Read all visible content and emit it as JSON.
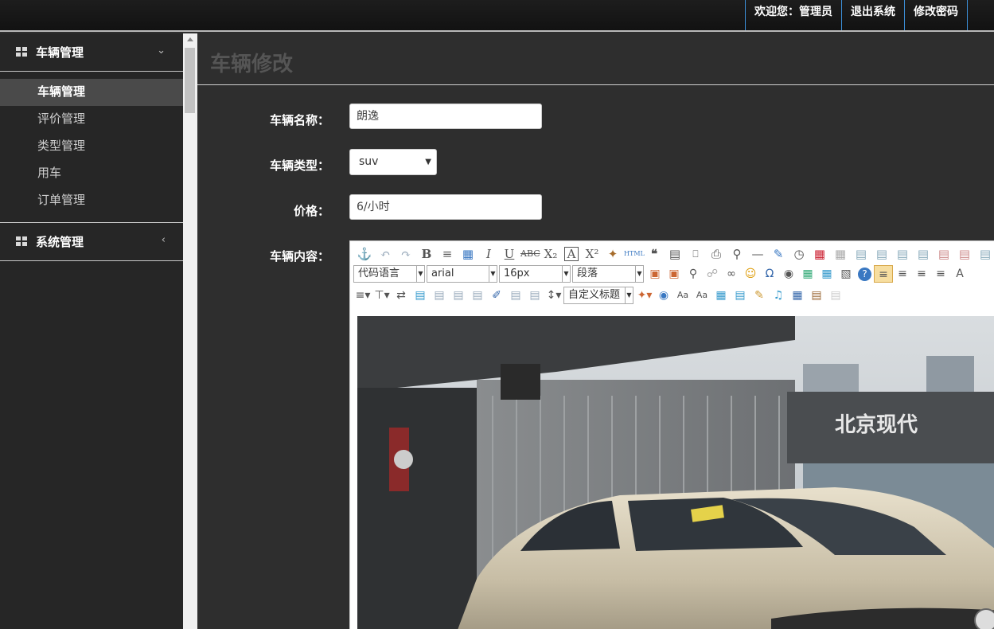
{
  "header": {
    "welcome": "欢迎您：管理员",
    "logout": "退出系统",
    "change_password": "修改密码"
  },
  "sidebar": {
    "groups": [
      {
        "title": "车辆管理",
        "expanded": true,
        "items": [
          {
            "label": "车辆管理",
            "active": true
          },
          {
            "label": "评价管理"
          },
          {
            "label": "类型管理"
          },
          {
            "label": "用车"
          },
          {
            "label": "订单管理"
          }
        ]
      },
      {
        "title": "系统管理",
        "expanded": false
      }
    ]
  },
  "main": {
    "page_title": "车辆修改",
    "form": {
      "name_label": "车辆名称：",
      "name_value": "朗逸",
      "type_label": "车辆类型：",
      "type_value": "suv",
      "price_label": "价格：",
      "price_value": "6/小时",
      "content_label": "车辆内容："
    },
    "editor": {
      "code_lang": "代码语言",
      "font_family": "arial",
      "font_size": "16px",
      "paragraph": "段落",
      "custom_title": "自定义标题",
      "html_btn": "HTML",
      "image_text": "北京现代"
    }
  },
  "colors": {
    "link_border": "#3c8fd8",
    "sidebar_bg": "#262626",
    "main_bg": "#2e2e2e"
  }
}
